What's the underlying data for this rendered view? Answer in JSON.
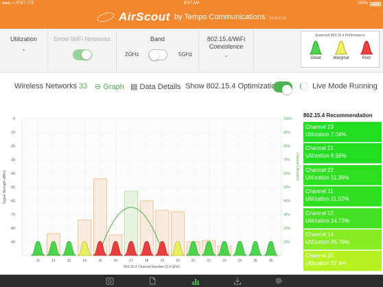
{
  "status": {
    "carrier": "●●●○○ AT&T  LTE",
    "time": "9:57 AM",
    "battery": "100%"
  },
  "brand": {
    "name": "AirScout",
    "by": "by   Tempo  Communications",
    "version": "v1.6.0.14"
  },
  "toolbar": {
    "utilization": "Utilization",
    "show_wifi": "Show WiFi Networks",
    "band": "Band",
    "band_2g": "2GHz",
    "band_5g": "5GHz",
    "coexist_line1": "802.15.4/WiFi",
    "coexist_line2": "Coexistence"
  },
  "performance": {
    "title": "Expected 802.15.4 Performance",
    "items": [
      {
        "label": "Good",
        "color": "#4dd44d"
      },
      {
        "label": "Marginal",
        "color": "#f0f060"
      },
      {
        "label": "Poor",
        "color": "#f04040"
      }
    ]
  },
  "info": {
    "networks_label": "Wireless Networks",
    "networks_count": "33",
    "graph": "Graph",
    "data_details": "Data Details",
    "optimization": "Show 802.15.4 Optimization",
    "live_mode": "Live Mode Running"
  },
  "recommendation": {
    "title": "802.15.4 Recommendation",
    "items": [
      {
        "channel": "Channel 23",
        "utilization": "Utilization 7.04%",
        "color": "#22dd22"
      },
      {
        "channel": "Channel 21",
        "utilization": "Utilization 9.56%",
        "color": "#22dd22"
      },
      {
        "channel": "Channel 22",
        "utilization": "Utilization 11.36%",
        "color": "#2fdf22"
      },
      {
        "channel": "Channel 11",
        "utilization": "Utilization 11.52%",
        "color": "#33df22"
      },
      {
        "channel": "Channel 12",
        "utilization": "Utilization 14.72%",
        "color": "#44e022"
      },
      {
        "channel": "Channel 14",
        "utilization": "Utilization 25.76%",
        "color": "#88ec22"
      },
      {
        "channel": "Channel 20",
        "utilization": "Utilization 37.4%",
        "color": "#b6f21f"
      }
    ]
  },
  "chart_data": {
    "type": "bar",
    "xlabel": "802.15.4 Channel Number (2.4 GHz)",
    "ylabel": "Signal Strength (dBm)",
    "ylabel_right": "Channel Utilization",
    "y_ticks": [
      0,
      -10,
      -20,
      -30,
      -40,
      -50,
      -60,
      -70,
      -80,
      -90
    ],
    "y2_ticks": [
      "100%",
      "90%",
      "80%",
      "70%",
      "60%",
      "50%",
      "40%",
      "30%",
      "20%",
      "10%"
    ],
    "ylim": [
      -100,
      0
    ],
    "categories": [
      "11",
      "12",
      "13",
      "14",
      "15",
      "16",
      "17",
      "18",
      "19",
      "20",
      "21",
      "22",
      "23",
      "24",
      "25",
      "26"
    ],
    "utilization_bars": [
      {
        "channel": 12,
        "value": 16
      },
      {
        "channel": 14,
        "value": 26
      },
      {
        "channel": 15,
        "value": 56
      },
      {
        "channel": 16,
        "value": 15
      },
      {
        "channel": 17,
        "value": 47
      },
      {
        "channel": 18,
        "value": 40
      },
      {
        "channel": 19,
        "value": 33
      },
      {
        "channel": 20,
        "value": 32
      },
      {
        "channel": 21,
        "value": 10
      },
      {
        "channel": 22,
        "value": 11
      },
      {
        "channel": 23,
        "value": 7
      }
    ],
    "wifi_network": {
      "center_channel": 17,
      "peak_dbm": -64
    },
    "channel_performance": [
      "good",
      "good",
      "good",
      "marginal",
      "poor",
      "poor",
      "poor",
      "poor",
      "poor",
      "marginal",
      "good",
      "good",
      "good",
      "good",
      "good",
      "good"
    ],
    "grid": true
  },
  "tabs": [
    {
      "name": "camera-icon"
    },
    {
      "name": "document-icon"
    },
    {
      "name": "chart-icon",
      "active": true
    },
    {
      "name": "download-icon"
    },
    {
      "name": "settings-icon"
    }
  ]
}
